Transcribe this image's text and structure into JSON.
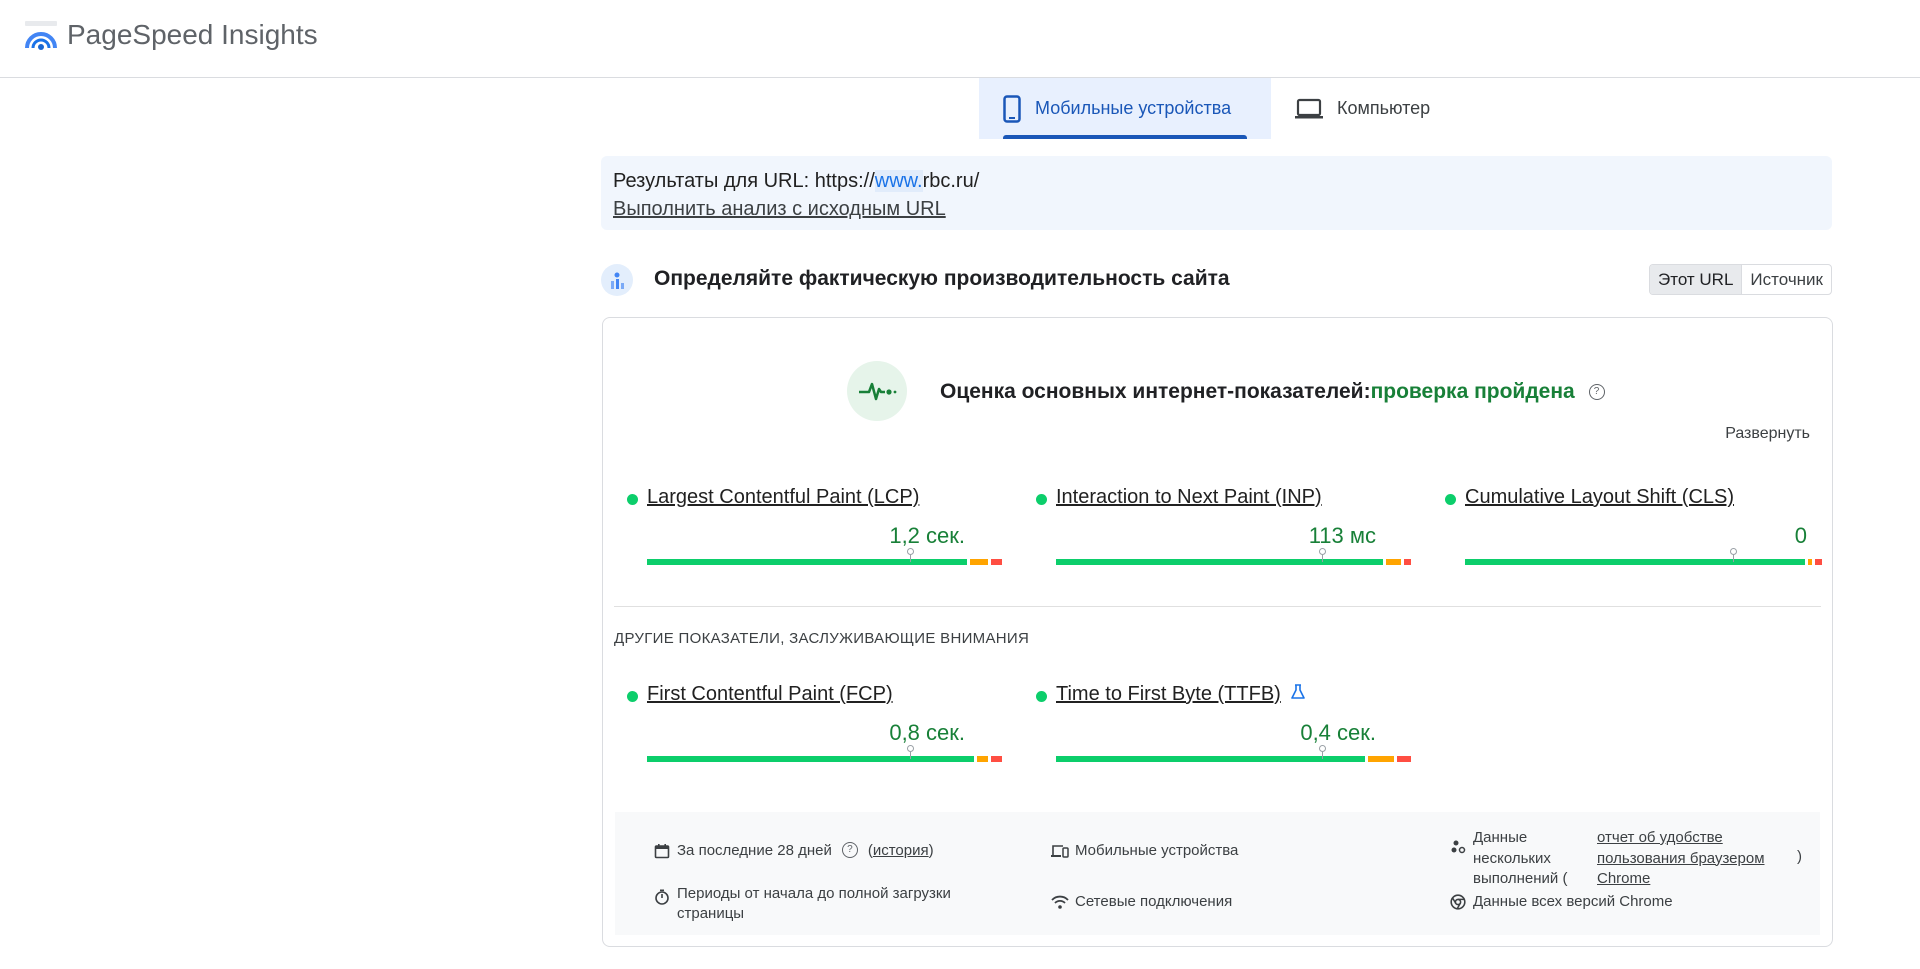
{
  "app": {
    "brand": "PageSpeed Insights"
  },
  "tabs": [
    {
      "label": "Мобильные устройства",
      "icon": "smartphone-icon",
      "active": true
    },
    {
      "label": "Компьютер",
      "icon": "laptop-icon",
      "active": false
    }
  ],
  "url_box": {
    "prefix": "Результаты для URL: https://",
    "highlight": "www.",
    "suffix": "rbc.ru/",
    "link": "Выполнить анализ с исходным URL"
  },
  "field_section": {
    "title": "Определяйте фактическую производительность сайта",
    "toggle": {
      "this_url": "Этот URL",
      "origin": "Источник"
    }
  },
  "cwv": {
    "title": "Оценка основных интернет-показателей:",
    "status": "проверка пройдена",
    "expand": "Развернуть",
    "metrics": [
      {
        "name": "Largest Contentful Paint (LCP)",
        "value": "1,2 сек.",
        "status": "good",
        "distribution": [
          0.91,
          0.06,
          0.03
        ],
        "marker": 0.74
      },
      {
        "name": "Interaction to Next Paint (INP)",
        "value": "113 мс",
        "status": "good",
        "distribution": [
          0.93,
          0.05,
          0.02
        ],
        "marker": 0.75
      },
      {
        "name": "Cumulative Layout Shift (CLS)",
        "value": "0",
        "status": "good",
        "distribution": [
          0.96,
          0.02,
          0.02
        ],
        "marker": 0.75
      }
    ]
  },
  "other": {
    "label": "ДРУГИЕ ПОКАЗАТЕЛИ, ЗАСЛУЖИВАЮЩИЕ ВНИМАНИЯ",
    "metrics": [
      {
        "name": "First Contentful Paint (FCP)",
        "value": "0,8 сек.",
        "status": "good",
        "distribution": [
          0.93,
          0.04,
          0.03
        ],
        "marker": 0.74
      },
      {
        "name": "Time to First Byte (TTFB)",
        "value": "0,4 сек.",
        "status": "good",
        "experimental_icon": "flask-icon",
        "distribution": [
          0.88,
          0.08,
          0.04
        ],
        "marker": 0.75
      }
    ]
  },
  "footer": {
    "period_text": "За последние 28 дней",
    "history_open": "(",
    "history_link": "история",
    "history_close": ")",
    "devices": "Мобильные устройства",
    "data_text": "Данные нескольких выполнений (",
    "crux_link": "отчет об удобстве пользования браузером Chrome",
    "crux_close": ")",
    "duration": "Периоды от начала до полной загрузки страницы",
    "network": "Сетевые подключения",
    "chrome": "Данные всех версий Chrome"
  },
  "colors": {
    "good": "#0cce6b",
    "average": "#ffa400",
    "poor": "#ff4e42",
    "pass_text": "#188038",
    "accent": "#1a57b8"
  }
}
